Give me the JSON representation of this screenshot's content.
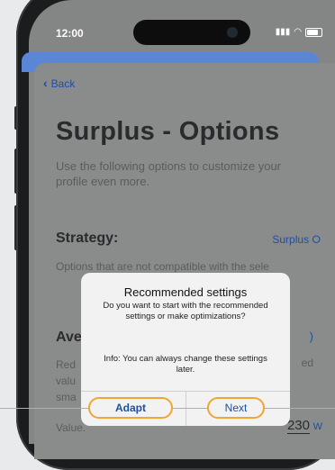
{
  "status": {
    "time": "12:00",
    "signal_icons": "∙∙∙ ◠"
  },
  "nav": {
    "back_label": "Back"
  },
  "page": {
    "title": "Surplus - Options",
    "subtitle": "Use the following options to customize your profile even more."
  },
  "strategy": {
    "label": "Strategy:",
    "value": "Surplus ⭘"
  },
  "description": {
    "text": "Options that are not compatible with the sele"
  },
  "average": {
    "label_partial": "Ave",
    "paren": ")"
  },
  "reduced": {
    "line1": "Red",
    "line2": "valu",
    "line3": "sma",
    "right_text": "ed"
  },
  "value_field": {
    "label": "Value.",
    "value": "230",
    "unit": "W"
  },
  "dialog": {
    "title": "Recommended settings",
    "message": "Do you want to start with the recommended settings or make optimizations?",
    "info": "Info: You can always change these settings later.",
    "adapt_label": "Adapt",
    "next_label": "Next"
  },
  "colors": {
    "accent": "#1d4fa3",
    "highlight": "#f0a630"
  }
}
